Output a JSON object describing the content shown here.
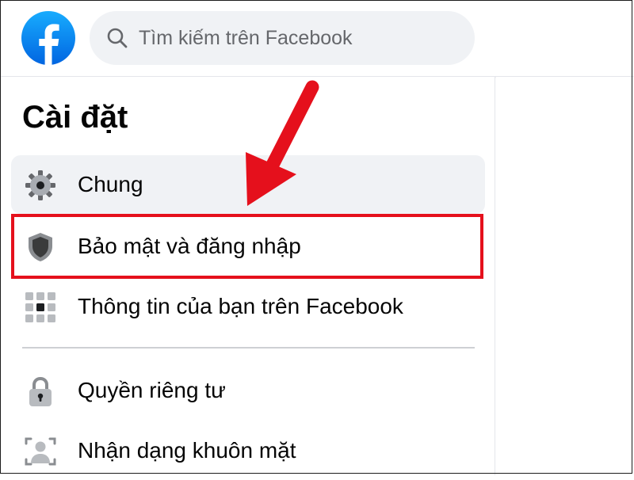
{
  "header": {
    "search_placeholder": "Tìm kiếm trên Facebook"
  },
  "sidebar": {
    "title": "Cài đặt",
    "items": [
      {
        "label": "Chung",
        "icon": "gear-icon",
        "active": true
      },
      {
        "label": "Bảo mật và đăng nhập",
        "icon": "shield-icon",
        "highlighted": true
      },
      {
        "label": "Thông tin của bạn trên Facebook",
        "icon": "grid-icon"
      },
      {
        "label": "Quyền riêng tư",
        "icon": "lock-icon"
      },
      {
        "label": "Nhận dạng khuôn mặt",
        "icon": "face-recognition-icon"
      }
    ]
  },
  "colors": {
    "brand_blue": "#1877f2",
    "highlight_red": "#e5101c",
    "search_bg": "#f0f2f5",
    "icon_gray": "#65676b"
  }
}
